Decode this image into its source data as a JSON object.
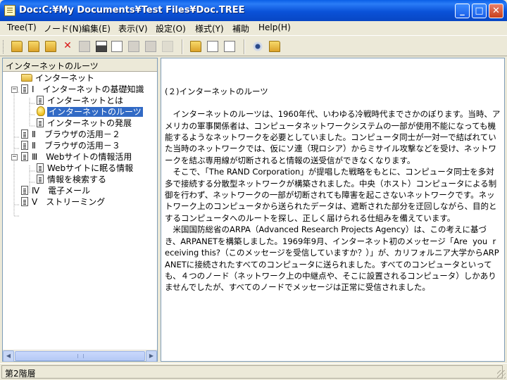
{
  "window": {
    "title": "Doc:C:¥My Documents¥Test Files¥Doc.TREE",
    "minimize_glyph": "_",
    "maximize_glyph": "□",
    "close_glyph": "✕",
    "titlebar_color": "#0a52d8"
  },
  "menu": [
    {
      "label": "Tree(T)"
    },
    {
      "label": "ノード(N)"
    },
    {
      "label": "編集(E)"
    },
    {
      "label": "表示(V)"
    },
    {
      "label": "設定(O)"
    },
    {
      "label": "様式(Y)"
    },
    {
      "label": "補助"
    },
    {
      "label": "Help(H)"
    }
  ],
  "toolbar_icons": [
    "open-folder-icon",
    "folder-up-icon",
    "new-folder-icon",
    "delete-icon",
    "page-icon",
    "print-icon",
    "print-preview-icon",
    "save-icon",
    "export-icon",
    "disabled-icon",
    "folder-icon",
    "list-icon",
    "search-icon",
    "view-icon",
    "tools-icon"
  ],
  "tree": {
    "header": "インターネットのルーツ",
    "items": [
      {
        "label": "インターネット",
        "icon": "folder-icon"
      },
      {
        "label": "Ⅰ　インターネットの基礎知識",
        "icon": "document-icon",
        "expander": "−"
      },
      {
        "label": "インターネットとは",
        "icon": "document-icon"
      },
      {
        "label": "インターネットのルーツ",
        "icon": "lightbulb-icon",
        "selected": true
      },
      {
        "label": "インターネットの発展",
        "icon": "document-icon"
      },
      {
        "label": "Ⅱ　ブラウザの活用－２",
        "icon": "document-icon"
      },
      {
        "label": "Ⅱ　ブラウザの活用－３",
        "icon": "document-icon"
      },
      {
        "label": "Ⅲ　Webサイトの情報活用",
        "icon": "document-icon",
        "expander": "−"
      },
      {
        "label": "Webサイトに眠る情報",
        "icon": "document-icon"
      },
      {
        "label": "情報を検索する",
        "icon": "document-icon"
      },
      {
        "label": "Ⅳ　電子メール",
        "icon": "document-icon"
      },
      {
        "label": "Ⅴ　ストリーミング",
        "icon": "document-icon"
      }
    ],
    "selection_color": "#316ac5"
  },
  "content": {
    "heading": "(２)インターネットのルーツ",
    "paragraphs": [
      "　インターネットのルーツは、1960年代、いわゆる冷戦時代までさかのぼります。当時、アメリカの軍事関係者は、コンピュータネットワークシステムの一部が使用不能になっても機能するようなネットワークを必要としていました。コンピュータ同士が一対一で結ばれていた当時のネットワークでは、仮にソ連（現ロシア）からミサイル攻撃などを受け、ネットワークを結ぶ専用線が切断されると情報の送受信ができなくなります。",
      "　そこで、「The RAND Corporation」が提唱した戦略をもとに、コンピュータ同士を多対多で接続する分散型ネットワークが構築されました。中央（ホスト）コンピュータによる制御を行わず、ネットワークの一部が切断されても障害を起こさないネットワークです。ネットワーク上のコンピュータから送られたデータは、遮断された部分を迂回しながら、目的とするコンピュータへのルートを探し、正しく届けられる仕組みを備えています。",
      "　米国国防総省のARPA（Advanced Research Projects Agency）は、この考えに基づき、ARPANETを構築しました。1969年9月、インターネット初のメッセージ「Are  you  receiving this?（このメッセージを受信していますか？）」が、カリフォルニア大学からARPANETに接続されたすべてのコンピュータに送られました。すべてのコンピュータといっても、４つのノード（ネットワーク上の中継点や、そこに設置されるコンピュータ）しかありませんでしたが、すべてのノードでメッセージは正常に受信されました。"
    ]
  },
  "status": {
    "text": "第2階層"
  }
}
